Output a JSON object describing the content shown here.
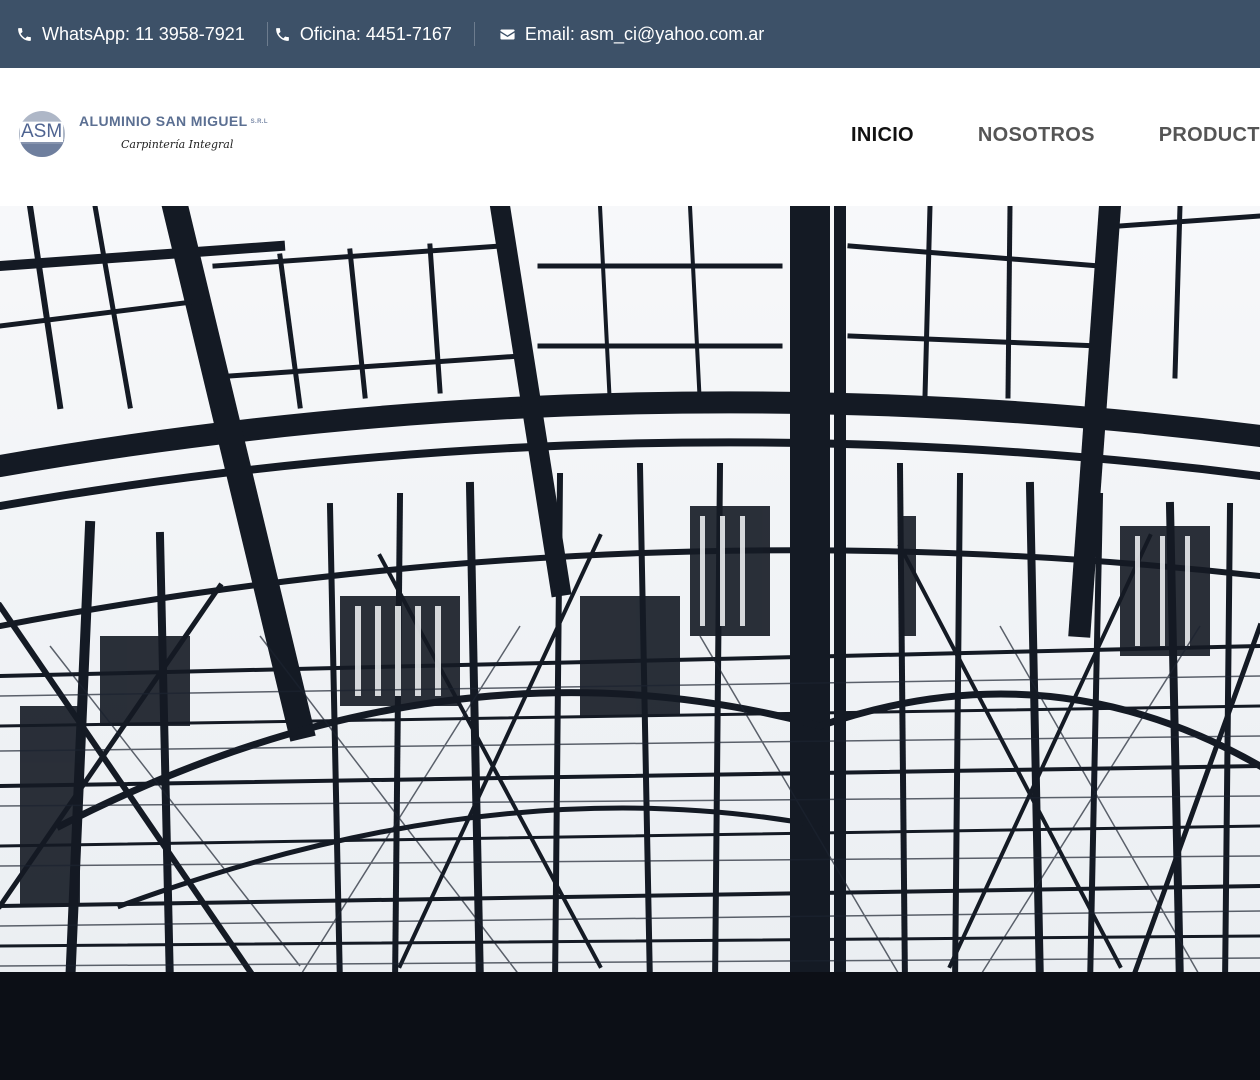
{
  "topbar": {
    "whatsapp": "WhatsApp: 11 3958-7921",
    "oficina": "Oficina: 4451-7167",
    "email": "Email: asm_ci@yahoo.com.ar"
  },
  "logo": {
    "mark": "ASM",
    "name": "ALUMINIO SAN MIGUEL",
    "srl": "S.R.L",
    "tagline": "Carpintería Integral"
  },
  "nav": {
    "items": [
      {
        "label": "INICIO",
        "active": true
      },
      {
        "label": "NOSOTROS",
        "active": false
      },
      {
        "label": "PRODUCT",
        "active": false
      }
    ]
  },
  "colors": {
    "topbar_bg": "#3d5168",
    "logo_blue": "#5b6f92",
    "nav_active": "#111111",
    "nav_default": "#555555"
  },
  "icons": {
    "whatsapp": "phone-icon",
    "oficina": "phone-icon",
    "email": "envelope-icon"
  }
}
